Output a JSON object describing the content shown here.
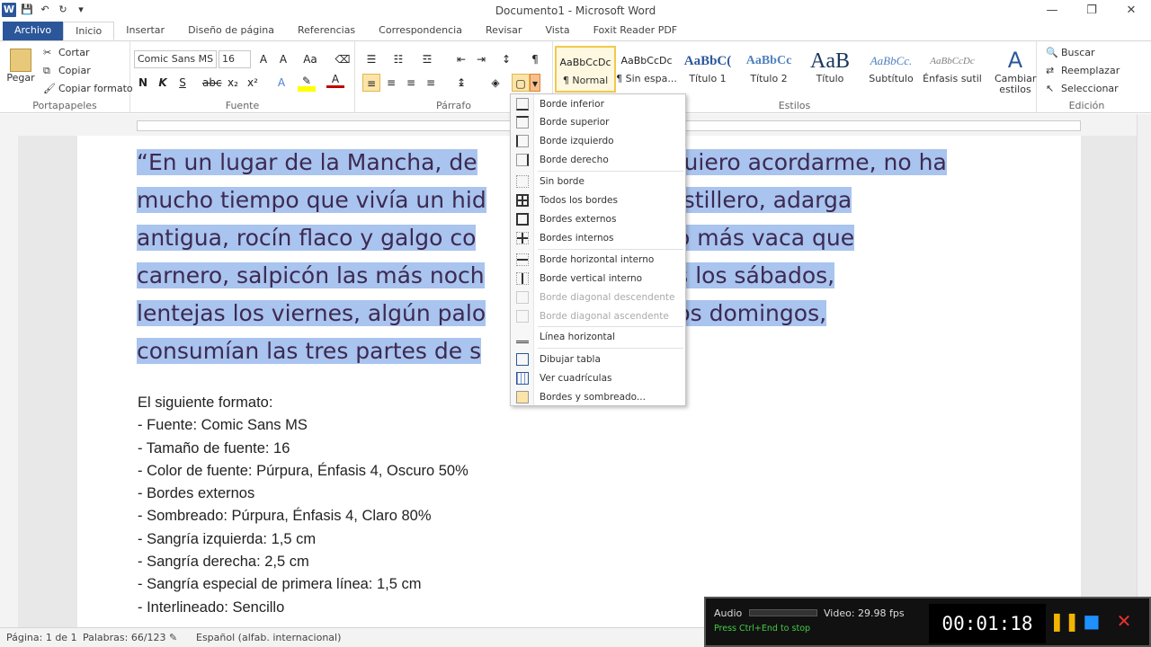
{
  "window": {
    "title": "Documento1 - Microsoft Word"
  },
  "tabs": [
    "Archivo",
    "Inicio",
    "Insertar",
    "Diseño de página",
    "Referencias",
    "Correspondencia",
    "Revisar",
    "Vista",
    "Foxit Reader PDF"
  ],
  "clipboard": {
    "paste": "Pegar",
    "cut": "Cortar",
    "copy": "Copiar",
    "format_painter": "Copiar formato",
    "label": "Portapapeles"
  },
  "font": {
    "family": "Comic Sans MS",
    "size": "16",
    "label": "Fuente"
  },
  "paragraph": {
    "label": "Párrafo"
  },
  "styles": {
    "items": [
      {
        "preview": "AaBbCcDc",
        "name": "¶ Normal"
      },
      {
        "preview": "AaBbCcDc",
        "name": "¶ Sin espa..."
      },
      {
        "preview": "AaBbC(",
        "name": "Título 1"
      },
      {
        "preview": "AaBbCc",
        "name": "Título 2"
      },
      {
        "preview": "AaB",
        "name": "Título"
      },
      {
        "preview": "AaBbCc.",
        "name": "Subtítulo"
      },
      {
        "preview": "AaBbCcDc",
        "name": "Énfasis sutil"
      }
    ],
    "change": "Cambiar estilos",
    "label": "Estilos"
  },
  "editing": {
    "find": "Buscar",
    "replace": "Reemplazar",
    "select": "Seleccionar",
    "label": "Edición"
  },
  "document": {
    "selected_lines": [
      "“En un lugar de la Mancha, de",
      "no quiero acordarme, no ha",
      "mucho tiempo que vivía un hid",
      "lanza en astillero, adarga",
      "antigua, rocín flaco y galgo co",
      "la de algo más vaca que",
      "carnero, salpicón las más noch",
      "uebrantos los sábados,",
      "lentejas los viernes, algún palo",
      "dura los domingos,",
      "consumían las tres partes de s"
    ],
    "format_list": [
      "El siguiente formato:",
      "- Fuente: Comic Sans MS",
      "- Tamaño de fuente: 16",
      "- Color de fuente: Púrpura, Énfasis 4, Oscuro 50%",
      "- Bordes externos",
      "- Sombreado: Púrpura, Énfasis 4, Claro 80%",
      "- Sangría izquierda: 1,5 cm",
      "- Sangría derecha: 2,5 cm",
      "- Sangría especial de primera línea: 1,5 cm",
      "- Interlineado: Sencillo"
    ]
  },
  "border_menu": [
    {
      "label": "Borde inferior",
      "enabled": true
    },
    {
      "label": "Borde superior",
      "enabled": true
    },
    {
      "label": "Borde izquierdo",
      "enabled": true
    },
    {
      "label": "Borde derecho",
      "enabled": true
    },
    {
      "label": "Sin borde",
      "enabled": true
    },
    {
      "label": "Todos los bordes",
      "enabled": true
    },
    {
      "label": "Bordes externos",
      "enabled": true
    },
    {
      "label": "Bordes internos",
      "enabled": true
    },
    {
      "label": "Borde horizontal interno",
      "enabled": true
    },
    {
      "label": "Borde vertical interno",
      "enabled": true
    },
    {
      "label": "Borde diagonal descendente",
      "enabled": false
    },
    {
      "label": "Borde diagonal ascendente",
      "enabled": false
    },
    {
      "label": "Línea horizontal",
      "enabled": true
    },
    {
      "label": "Dibujar tabla",
      "enabled": true
    },
    {
      "label": "Ver cuadrículas",
      "enabled": true
    },
    {
      "label": "Bordes y sombreado...",
      "enabled": true
    }
  ],
  "status": {
    "page": "Página: 1 de 1",
    "words": "Palabras: 66/123",
    "language": "Español (alfab. internacional)"
  },
  "recorder": {
    "audio": "Audio",
    "video": "Video: 29.98 fps",
    "hint": "Press Ctrl+End to stop",
    "time": "00:01:18"
  }
}
